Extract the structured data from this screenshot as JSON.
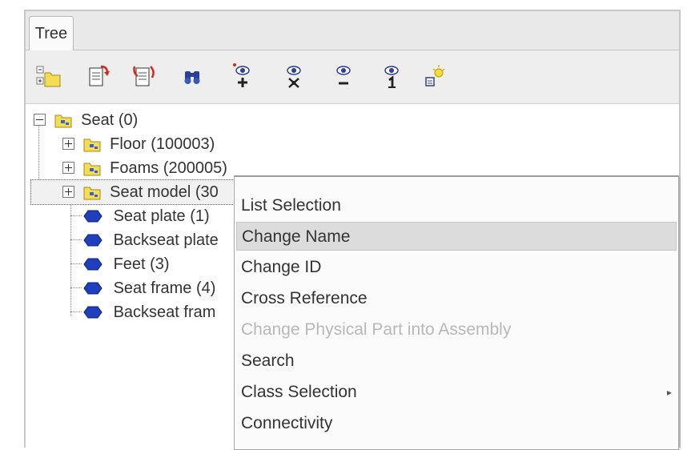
{
  "tab": {
    "label": "Tree"
  },
  "toolbar": {
    "buttons": [
      {
        "name": "expand-collapse-tree-icon"
      },
      {
        "name": "copy-properties-icon"
      },
      {
        "name": "paste-properties-icon"
      },
      {
        "name": "find-binoculars-icon"
      },
      {
        "name": "show-add-icon"
      },
      {
        "name": "show-only-icon"
      },
      {
        "name": "hide-icon"
      },
      {
        "name": "show-one-icon"
      },
      {
        "name": "lightbulb-settings-icon"
      }
    ]
  },
  "tree": {
    "nodes": [
      {
        "label": "Seat (0)"
      },
      {
        "label": "Floor (100003)"
      },
      {
        "label": "Foams (200005)"
      },
      {
        "label": "Seat model (30"
      },
      {
        "label": "Seat plate (1)"
      },
      {
        "label": "Backseat plate"
      },
      {
        "label": "Feet (3)"
      },
      {
        "label": "Seat frame (4)"
      },
      {
        "label": "Backseat fram"
      }
    ]
  },
  "context_menu": {
    "items": [
      {
        "label": "List Selection",
        "state": "normal"
      },
      {
        "label": "Change Name",
        "state": "hover"
      },
      {
        "label": "Change ID",
        "state": "normal"
      },
      {
        "label": "Cross Reference",
        "state": "normal"
      },
      {
        "label": "Change Physical Part into Assembly",
        "state": "disabled"
      },
      {
        "label": "Search",
        "state": "normal"
      },
      {
        "label": "Class Selection",
        "state": "normal",
        "submenu_arrow": "▸"
      },
      {
        "label": "Connectivity",
        "state": "normal"
      }
    ]
  },
  "colors": {
    "part_icon": "#1f3fbf",
    "folder_icon": "#f2d640",
    "eye_icon": "#2a3f9a",
    "accent_red": "#d22a1e"
  }
}
